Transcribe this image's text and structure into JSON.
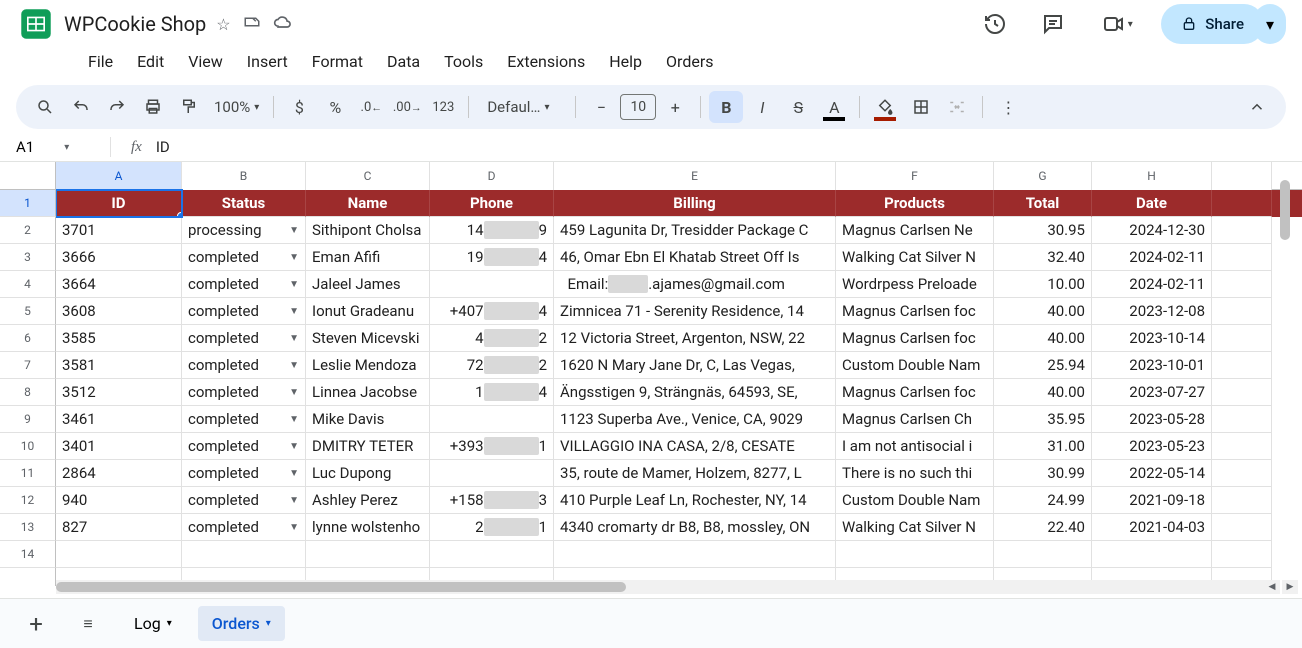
{
  "doc": {
    "title": "WPCookie Shop"
  },
  "menus": [
    "File",
    "Edit",
    "View",
    "Insert",
    "Format",
    "Data",
    "Tools",
    "Extensions",
    "Help",
    "Orders"
  ],
  "toolbar": {
    "zoom": "100%",
    "font": "Defaul…",
    "fontSize": "10"
  },
  "share": {
    "label": "Share"
  },
  "namebox": {
    "ref": "A1",
    "formula": "ID"
  },
  "colLetters": [
    "A",
    "B",
    "C",
    "D",
    "E",
    "F",
    "G",
    "H"
  ],
  "headers": [
    "ID",
    "Status",
    "Name",
    "Phone",
    "Billing",
    "Products",
    "Total",
    "Date"
  ],
  "rows": [
    {
      "n": "2",
      "id": "3701",
      "status": "processing",
      "name": "Sithipont Cholsa",
      "phPre": "14",
      "phPost": "9",
      "billing": "459 Lagunita Dr, Tresidder Package C",
      "products": "Magnus Carlsen Ne",
      "total": "30.95",
      "date": "2024-12-30"
    },
    {
      "n": "3",
      "id": "3666",
      "status": "completed",
      "name": "Eman Afifi",
      "phPre": "19",
      "phPost": "4",
      "billing": "46, Omar Ebn El Khatab Street Off Is",
      "products": "Walking Cat Silver N",
      "total": "32.40",
      "date": "2024-02-11"
    },
    {
      "n": "4",
      "id": "3664",
      "status": "completed",
      "name": "Jaleel James",
      "phPre": "",
      "phPost": "",
      "billing": "Email:         .ajames@gmail.com",
      "products": "Wordrpess Preloade",
      "total": "10.00",
      "date": "2024-02-11",
      "emailRedact": true
    },
    {
      "n": "5",
      "id": "3608",
      "status": "completed",
      "name": "Ionut Gradeanu",
      "phPre": "+407",
      "phPost": "4",
      "billing": "Zimnicea 71 - Serenity Residence, 14",
      "products": "Magnus Carlsen foc",
      "total": "40.00",
      "date": "2023-12-08"
    },
    {
      "n": "6",
      "id": "3585",
      "status": "completed",
      "name": "Steven Micevski",
      "phPre": "4",
      "phPost": "2",
      "billing": "12 Victoria Street, Argenton, NSW, 22",
      "products": "Magnus Carlsen foc",
      "total": "40.00",
      "date": "2023-10-14"
    },
    {
      "n": "7",
      "id": "3581",
      "status": "completed",
      "name": "Leslie Mendoza",
      "phPre": "72",
      "phPost": "2",
      "billing": "1620 N Mary Jane Dr, C, Las Vegas, ",
      "products": "Custom Double Nam",
      "total": "25.94",
      "date": "2023-10-01"
    },
    {
      "n": "8",
      "id": "3512",
      "status": "completed",
      "name": "Linnea Jacobse",
      "phPre": "1",
      "phPost": "4",
      "billing": "Ängsstigen 9, Strängnäs, 64593, SE,",
      "products": "Magnus Carlsen foc",
      "total": "40.00",
      "date": "2023-07-27"
    },
    {
      "n": "9",
      "id": "3461",
      "status": "completed",
      "name": "Mike Davis",
      "phPre": "",
      "phPost": "",
      "billing": "1123 Superba Ave., Venice, CA, 9029",
      "products": "Magnus Carlsen Ch",
      "total": "35.95",
      "date": "2023-05-28"
    },
    {
      "n": "10",
      "id": "3401",
      "status": "completed",
      "name": "DMITRY TETER",
      "phPre": "+393",
      "phPost": "1",
      "billing": "VILLAGGIO INA CASA, 2/8, CESATE",
      "products": "I am not antisocial i ",
      "total": "31.00",
      "date": "2023-05-23"
    },
    {
      "n": "11",
      "id": "2864",
      "status": "completed",
      "name": "Luc Dupong",
      "phPre": "",
      "phPost": "",
      "billing": "35, route de Mamer, Holzem, 8277, L",
      "products": "There is no such thi",
      "total": "30.99",
      "date": "2022-05-14"
    },
    {
      "n": "12",
      "id": "940",
      "status": "completed",
      "name": "Ashley Perez",
      "phPre": "+158",
      "phPost": "3",
      "billing": "410 Purple Leaf Ln, Rochester, NY, 14",
      "products": "Custom Double Nam",
      "total": "24.99",
      "date": "2021-09-18"
    },
    {
      "n": "13",
      "id": "827",
      "status": "completed",
      "name": "lynne wolstenho",
      "phPre": "2",
      "phPost": "1",
      "billing": "4340 cromarty dr B8, B8, mossley, ON",
      "products": "Walking Cat Silver N",
      "total": "22.40",
      "date": "2021-04-03"
    }
  ],
  "tabs": {
    "log": "Log",
    "orders": "Orders"
  }
}
